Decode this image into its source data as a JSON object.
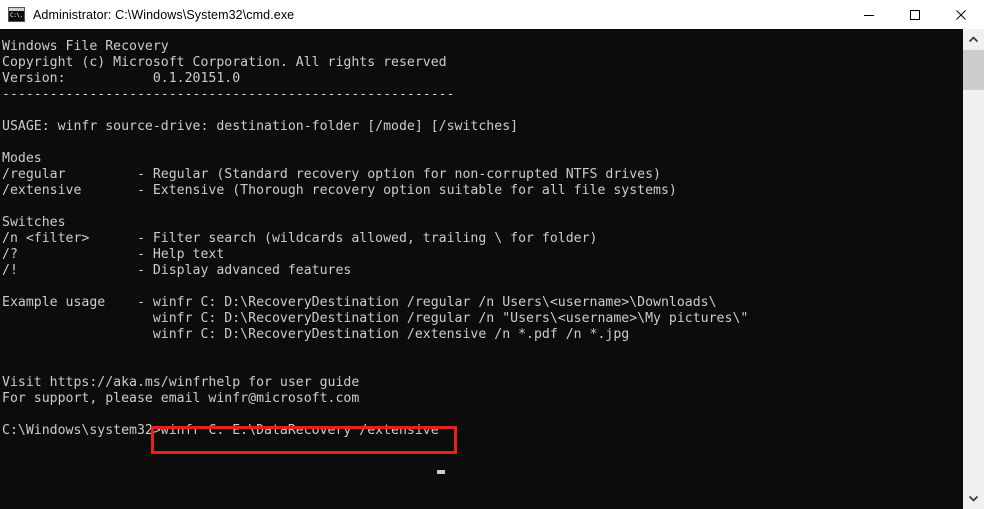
{
  "window": {
    "title": "Administrator: C:\\Windows\\System32\\cmd.exe",
    "icon": "cmd-console-icon",
    "icon_glyph": "C:\\.",
    "background_color": "#0c0c0c",
    "titlebar_color": "#ffffff",
    "text_color": "#cccccc"
  },
  "controls": {
    "minimize_label": "Minimize",
    "maximize_label": "Maximize",
    "close_label": "Close"
  },
  "scrollbar": {
    "up_arrow": "⌃",
    "down_arrow": "⌄",
    "thumb_label": "scroll-thumb"
  },
  "annotation": {
    "color": "#e8201a",
    "target_text": "winfr C: E:\\DataRecovery /extensive"
  },
  "console": {
    "lines": [
      "Windows File Recovery",
      "Copyright (c) Microsoft Corporation. All rights reserved",
      "Version:           0.1.20151.0",
      "---------------------------------------------------------",
      "",
      "USAGE: winfr source-drive: destination-folder [/mode] [/switches]",
      "",
      "Modes",
      "/regular         - Regular (Standard recovery option for non-corrupted NTFS drives)",
      "/extensive       - Extensive (Thorough recovery option suitable for all file systems)",
      "",
      "Switches",
      "/n <filter>      - Filter search (wildcards allowed, trailing \\ for folder)",
      "/?               - Help text",
      "/!               - Display advanced features",
      "",
      "Example usage    - winfr C: D:\\RecoveryDestination /regular /n Users\\<username>\\Downloads\\",
      "                   winfr C: D:\\RecoveryDestination /regular /n \"Users\\<username>\\My pictures\\\"",
      "                   winfr C: D:\\RecoveryDestination /extensive /n *.pdf /n *.jpg",
      "",
      "",
      "Visit https://aka.ms/winfrhelp for user guide",
      "For support, please email winfr@microsoft.com",
      "",
      "C:\\Windows\\system32>winfr C: E:\\DataRecovery /extensive"
    ],
    "full_text": "Windows File Recovery\nCopyright (c) Microsoft Corporation. All rights reserved\nVersion:           0.1.20151.0\n---------------------------------------------------------\n\nUSAGE: winfr source-drive: destination-folder [/mode] [/switches]\n\nModes\n/regular         - Regular (Standard recovery option for non-corrupted NTFS drives)\n/extensive       - Extensive (Thorough recovery option suitable for all file systems)\n\nSwitches\n/n <filter>      - Filter search (wildcards allowed, trailing \\ for folder)\n/?               - Help text\n/!               - Display advanced features\n\nExample usage    - winfr C: D:\\RecoveryDestination /regular /n Users\\<username>\\Downloads\\\n                   winfr C: D:\\RecoveryDestination /regular /n \"Users\\<username>\\My pictures\\\"\n                   winfr C: D:\\RecoveryDestination /extensive /n *.pdf /n *.jpg\n\n\nVisit https://aka.ms/winfrhelp for user guide\nFor support, please email winfr@microsoft.com\n\nC:\\Windows\\system32>winfr C: E:\\DataRecovery /extensive",
    "prompt": "C:\\Windows\\system32>",
    "command": "winfr C: E:\\DataRecovery /extensive",
    "program_name": "Windows File Recovery",
    "version": "0.1.20151.0",
    "help_url": "https://aka.ms/winfrhelp",
    "support_email": "winfr@microsoft.com"
  }
}
